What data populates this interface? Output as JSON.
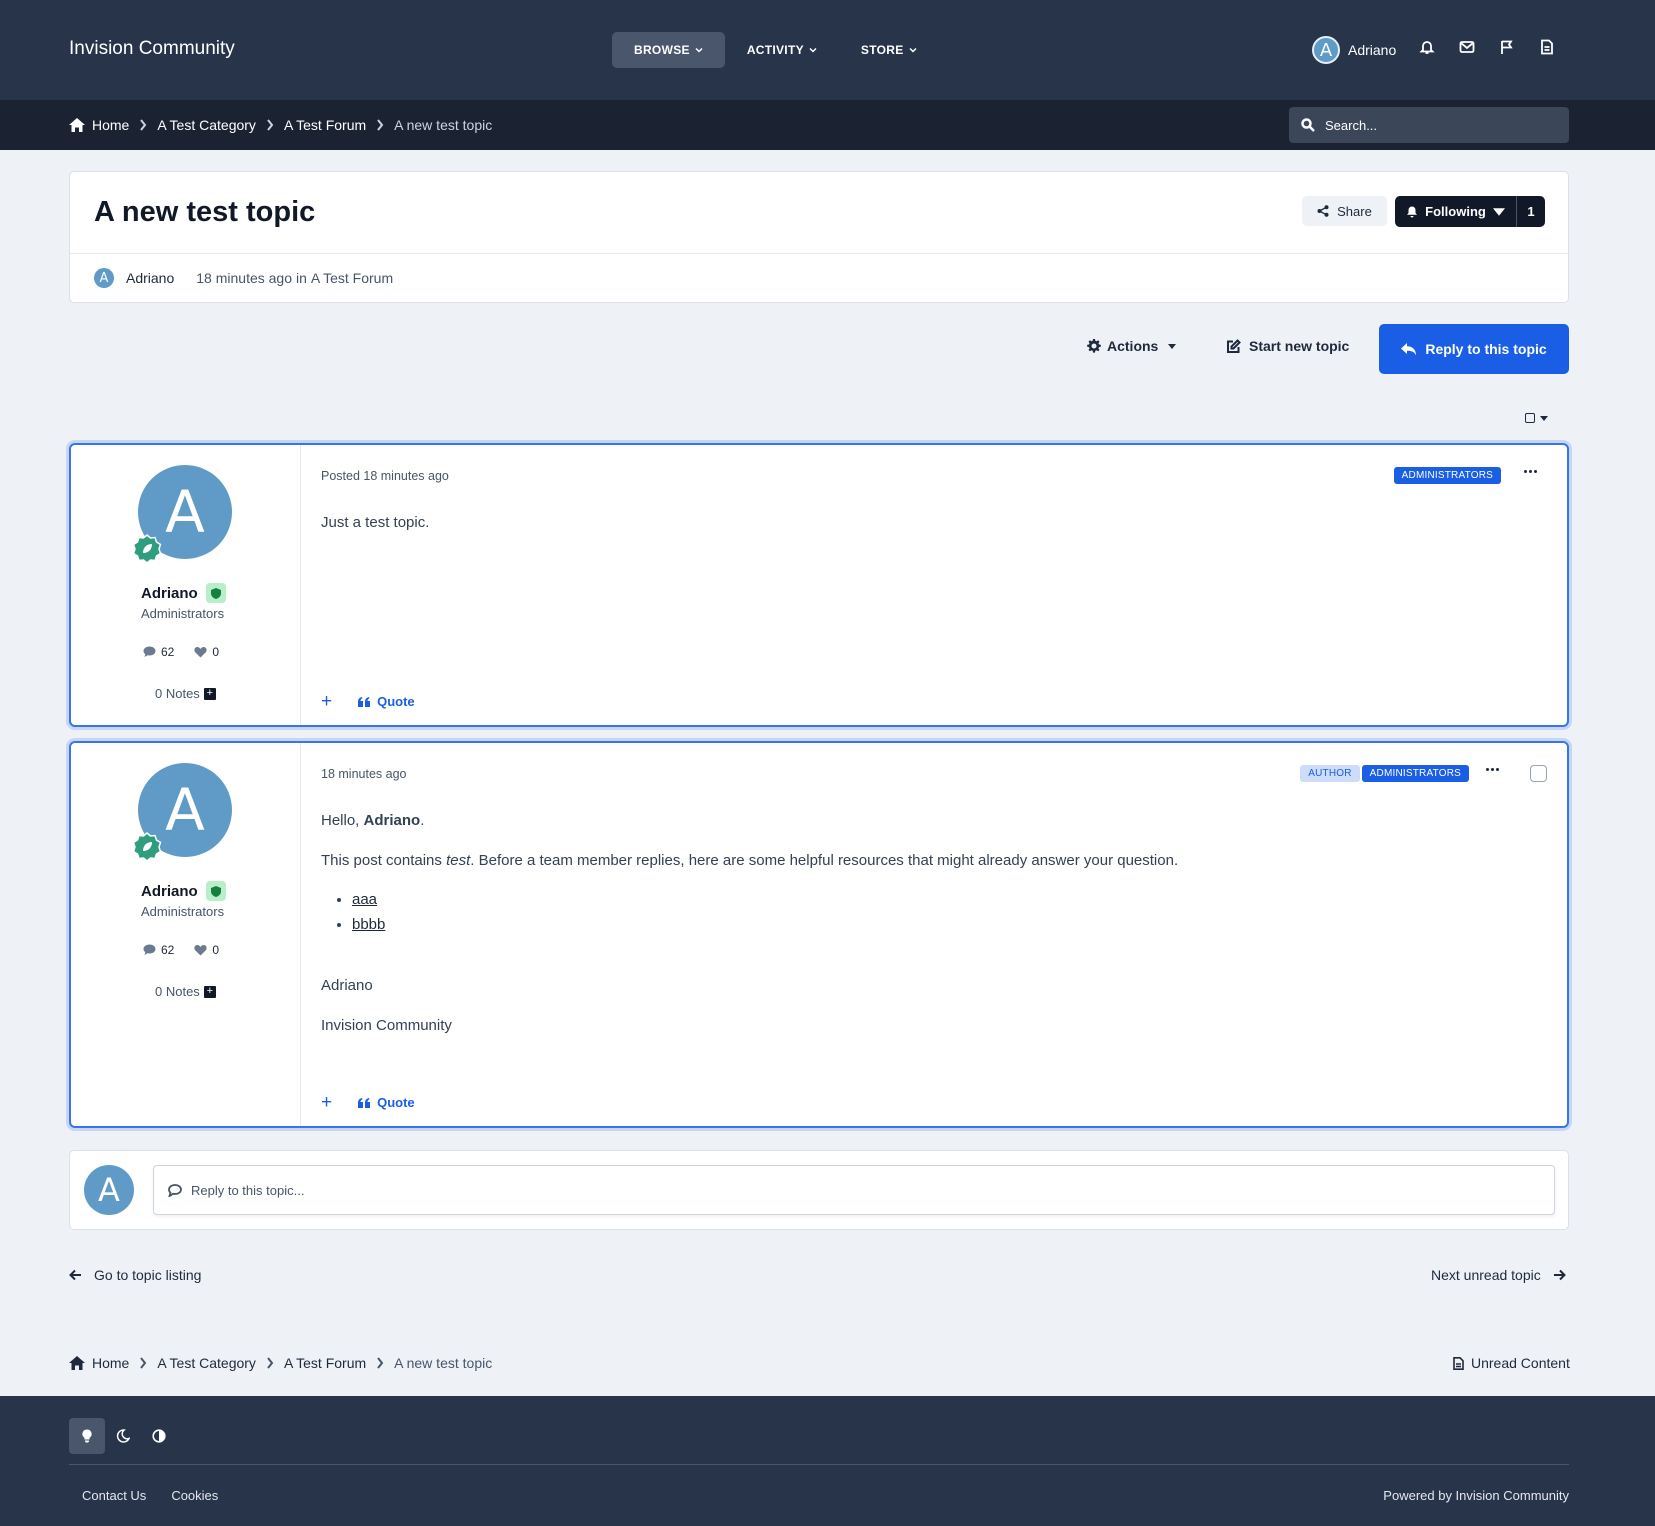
{
  "header": {
    "brand": "Invision Community",
    "nav": [
      {
        "label": "BROWSE",
        "active": true
      },
      {
        "label": "ACTIVITY",
        "active": false
      },
      {
        "label": "STORE",
        "active": false
      }
    ],
    "user": {
      "initial": "A",
      "name": "Adriano"
    },
    "icons": [
      "bell-icon",
      "envelope-icon",
      "flag-icon",
      "document-icon"
    ]
  },
  "breadcrumb": {
    "home": "Home",
    "items": [
      "A Test Category",
      "A Test Forum"
    ],
    "current": "A new test topic"
  },
  "search": {
    "placeholder": "Search..."
  },
  "topic": {
    "title": "A new test topic",
    "author": "Adriano",
    "author_initial": "A",
    "time": "18 minutes ago",
    "in_word": "in",
    "forum": "A Test Forum",
    "share_label": "Share",
    "following_label": "Following",
    "followers_count": "1"
  },
  "toolbar": {
    "actions_label": "Actions",
    "start_label": "Start new topic",
    "reply_label": "Reply to this topic"
  },
  "posts": [
    {
      "author": "Adriano",
      "initial": "A",
      "group": "Administrators",
      "post_count": "62",
      "reputation": "0",
      "notes": "0 Notes",
      "date": "Posted 18 minutes ago",
      "tags": [
        "ADMINISTRATORS"
      ],
      "content": "Just a test topic.",
      "quote_label": "Quote"
    },
    {
      "author": "Adriano",
      "initial": "A",
      "group": "Administrators",
      "post_count": "62",
      "reputation": "0",
      "notes": "0 Notes",
      "date": "18 minutes ago",
      "tags": [
        "AUTHOR",
        "ADMINISTRATORS"
      ],
      "greeting": "Hello,",
      "greeting_name": "Adriano",
      "greeting_end": ".",
      "line_before": "This post contains",
      "line_em": "test",
      "line_after": ". Before a team member replies, here are some helpful resources that might already answer your question.",
      "links": [
        "aaa",
        "bbbb"
      ],
      "signature_name": "Adriano",
      "signature_site": "Invision Community",
      "quote_label": "Quote"
    }
  ],
  "reply_box": {
    "initial": "A",
    "placeholder": "Reply to this topic..."
  },
  "pager": {
    "prev": "Go to topic listing",
    "next": "Next unread topic"
  },
  "unread_content": "Unread Content",
  "footer": {
    "links": [
      "Contact Us",
      "Cookies"
    ],
    "powered": "Powered by Invision Community"
  },
  "colors": {
    "accent": "#1a5ee6",
    "header_bg": "#283449",
    "breadcrumb_bg": "#1b2333"
  }
}
